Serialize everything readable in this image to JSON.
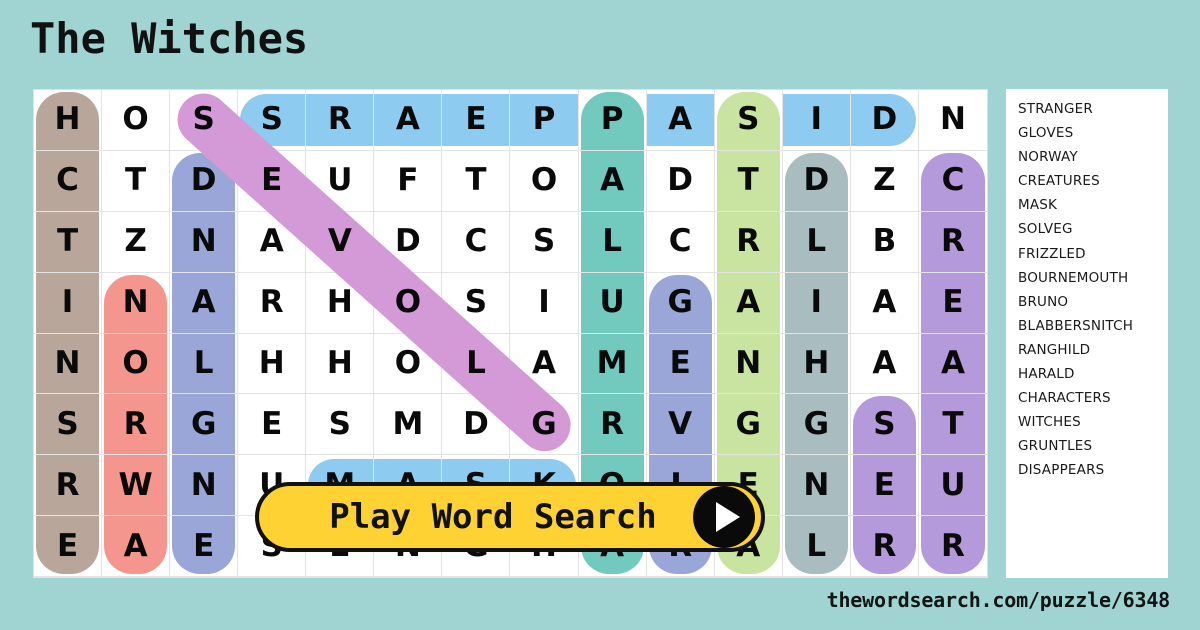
{
  "title": "The Witches",
  "footer": {
    "url": "thewordsearch.com/puzzle/6348"
  },
  "play_button": {
    "label": "Play Word Search",
    "icon": "play-triangle-icon"
  },
  "colors": {
    "background": "#9fd4d2",
    "grid_background": "#ffffff",
    "button_fill": "#ffd233",
    "button_border": "#111111",
    "highlight_blue": "#8ecbf0",
    "highlight_purple": "#d49ad8",
    "highlight_brown": "#b9a69b",
    "highlight_periwinkle": "#9aa6d8",
    "highlight_salmon": "#f5968e",
    "highlight_teal": "#72c9bd",
    "highlight_lime": "#c9e3a0",
    "highlight_gray": "#a9bcc0",
    "highlight_violet": "#b49ada"
  },
  "grid": {
    "rows": 8,
    "cols": 14,
    "letters": [
      [
        "H",
        "O",
        "S",
        "S",
        "R",
        "A",
        "E",
        "P",
        "P",
        "A",
        "S",
        "I",
        "D",
        "N"
      ],
      [
        "C",
        "T",
        "D",
        "E",
        "U",
        "F",
        "T",
        "O",
        "A",
        "D",
        "T",
        "D",
        "Z",
        "C"
      ],
      [
        "T",
        "Z",
        "N",
        "A",
        "V",
        "D",
        "C",
        "S",
        "L",
        "C",
        "R",
        "L",
        "B",
        "R"
      ],
      [
        "I",
        "N",
        "A",
        "R",
        "H",
        "O",
        "S",
        "I",
        "U",
        "G",
        "A",
        "I",
        "A",
        "E"
      ],
      [
        "N",
        "O",
        "L",
        "H",
        "H",
        "O",
        "L",
        "A",
        "M",
        "E",
        "N",
        "H",
        "A",
        "A"
      ],
      [
        "S",
        "R",
        "G",
        "E",
        "S",
        "M",
        "D",
        "G",
        "R",
        "V",
        "G",
        "G",
        "S",
        "T"
      ],
      [
        "R",
        "W",
        "N",
        "U",
        "M",
        "A",
        "S",
        "K",
        "O",
        "L",
        "E",
        "N",
        "E",
        "U"
      ],
      [
        "E",
        "A",
        "E",
        "S",
        "E",
        "N",
        "G",
        "H",
        "A",
        "R",
        "A",
        "L",
        "R",
        "R"
      ]
    ],
    "highlights": [
      {
        "word": "CHARACTERS",
        "color": "#b9a69b",
        "orientation": "vertical",
        "col": 0,
        "row_start": 0,
        "row_end": 7
      },
      {
        "word": "DISAPPEARS",
        "color": "#8ecbf0",
        "orientation": "horizontal",
        "row": 0,
        "col_start": 3,
        "col_end": 12
      },
      {
        "word": "GLOVES",
        "color": "#d49ad8",
        "orientation": "diagonal",
        "row_start": 0,
        "col_start": 2,
        "row_end": 5,
        "col_end": 7
      },
      {
        "word": "NORWAY",
        "color": "#f5968e",
        "orientation": "vertical",
        "col": 1,
        "row_start": 3,
        "row_end": 7
      },
      {
        "word": "BLABBERSNITCH",
        "color": "#9aa6d8",
        "orientation": "vertical",
        "col": 2,
        "row_start": 1,
        "row_end": 7
      },
      {
        "word": "MASK",
        "color": "#8ecbf0",
        "orientation": "horizontal",
        "row": 6,
        "col_start": 4,
        "col_end": 7
      },
      {
        "word": "SOLVEG",
        "color": "#72c9bd",
        "orientation": "vertical",
        "col": 8,
        "row_start": 0,
        "row_end": 7
      },
      {
        "word": "BRUNO",
        "color": "#9aa6d8",
        "orientation": "vertical",
        "col": 9,
        "row_start": 3,
        "row_end": 7
      },
      {
        "word": "STRANGER",
        "color": "#c9e3a0",
        "orientation": "vertical",
        "col": 10,
        "row_start": 0,
        "row_end": 7
      },
      {
        "word": "FRIZZLED",
        "color": "#a9bcc0",
        "orientation": "vertical",
        "col": 11,
        "row_start": 1,
        "row_end": 7
      },
      {
        "word": "GRUNTLES",
        "color": "#b49ada",
        "orientation": "vertical",
        "col": 12,
        "row_start": 5,
        "row_end": 7
      },
      {
        "word": "CREATURES",
        "color": "#b49ada",
        "orientation": "vertical",
        "col": 13,
        "row_start": 1,
        "row_end": 7
      }
    ]
  },
  "word_list": [
    "STRANGER",
    "GLOVES",
    "NORWAY",
    "CREATURES",
    "MASK",
    "SOLVEG",
    "FRIZZLED",
    "BOURNEMOUTH",
    "BRUNO",
    "BLABBERSNITCH",
    "RANGHILD",
    "HARALD",
    "CHARACTERS",
    "WITCHES",
    "GRUNTLES",
    "DISAPPEARS"
  ]
}
